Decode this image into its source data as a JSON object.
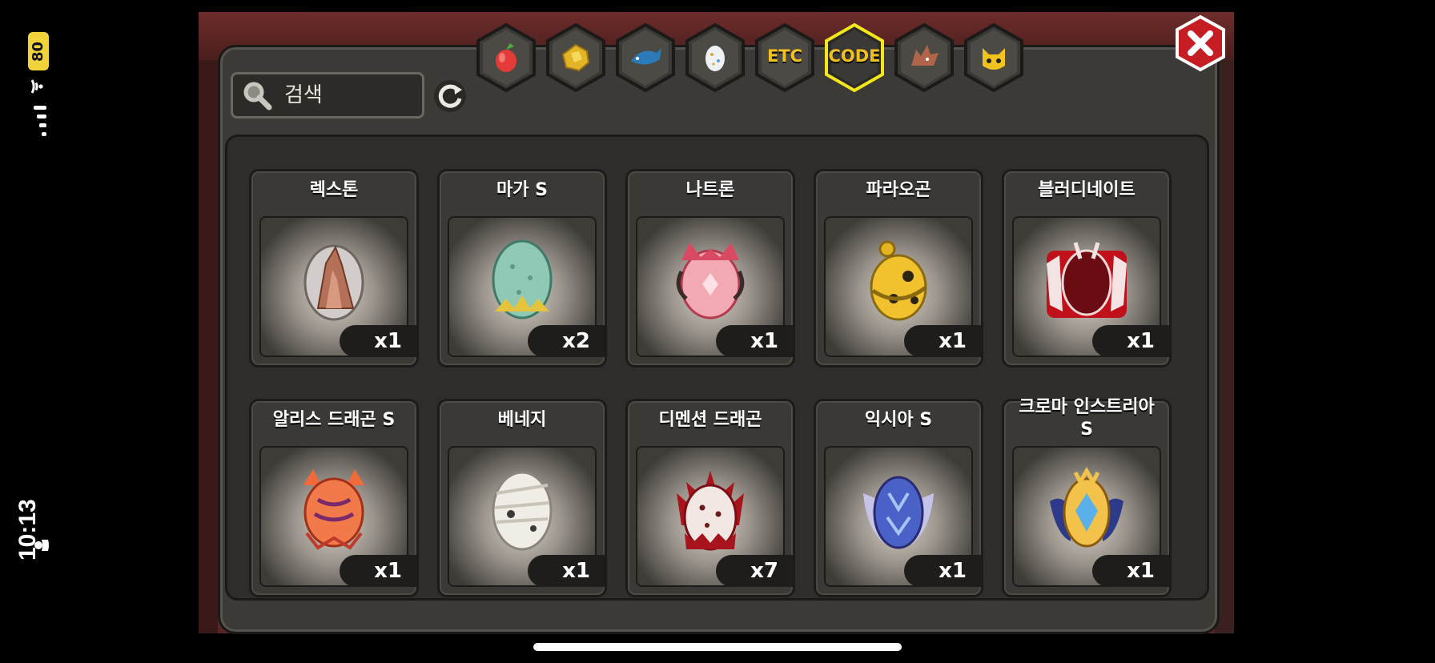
{
  "status": {
    "time": "10:13",
    "battery": "80"
  },
  "search": {
    "placeholder": "검색"
  },
  "tabs": [
    {
      "id": "fruit",
      "icon": "pear-fruit-icon",
      "selected": false
    },
    {
      "id": "gold",
      "icon": "gold-ore-icon",
      "selected": false
    },
    {
      "id": "fish",
      "icon": "blue-fish-icon",
      "selected": false
    },
    {
      "id": "egg",
      "icon": "egg-icon",
      "selected": false
    },
    {
      "id": "etc",
      "label": "ETC",
      "selected": false
    },
    {
      "id": "code",
      "label": "CODE",
      "selected": true
    },
    {
      "id": "dragon",
      "icon": "dragon-head-icon",
      "selected": false
    },
    {
      "id": "monster",
      "icon": "yellow-monster-icon",
      "selected": false
    }
  ],
  "items": [
    {
      "name": "렉스톤",
      "qty": "x1",
      "icon": "rock-egg-icon"
    },
    {
      "name": "마가 S",
      "qty": "x2",
      "icon": "green-egg-icon"
    },
    {
      "name": "나트론",
      "qty": "x1",
      "icon": "pink-dragon-egg-icon"
    },
    {
      "name": "파라오곤",
      "qty": "x1",
      "icon": "pharaoh-egg-icon"
    },
    {
      "name": "블러디네이트",
      "qty": "x1",
      "icon": "bloody-egg-icon"
    },
    {
      "name": "알리스 드래곤 S",
      "qty": "x1",
      "icon": "orange-dragon-egg-icon"
    },
    {
      "name": "베네지",
      "qty": "x1",
      "icon": "bandaged-egg-icon"
    },
    {
      "name": "디멘션 드래곤",
      "qty": "x7",
      "icon": "dimension-egg-icon"
    },
    {
      "name": "익시아 S",
      "qty": "x1",
      "icon": "winged-blue-egg-icon"
    },
    {
      "name": "크로마 인스트리아\nS",
      "qty": "x1",
      "icon": "chroma-egg-icon"
    }
  ],
  "colors": {
    "panel": "#3b3a36",
    "selected_tab_border": "#f3e61a",
    "close": "#d8202a",
    "tab_text": "#f0c020"
  }
}
